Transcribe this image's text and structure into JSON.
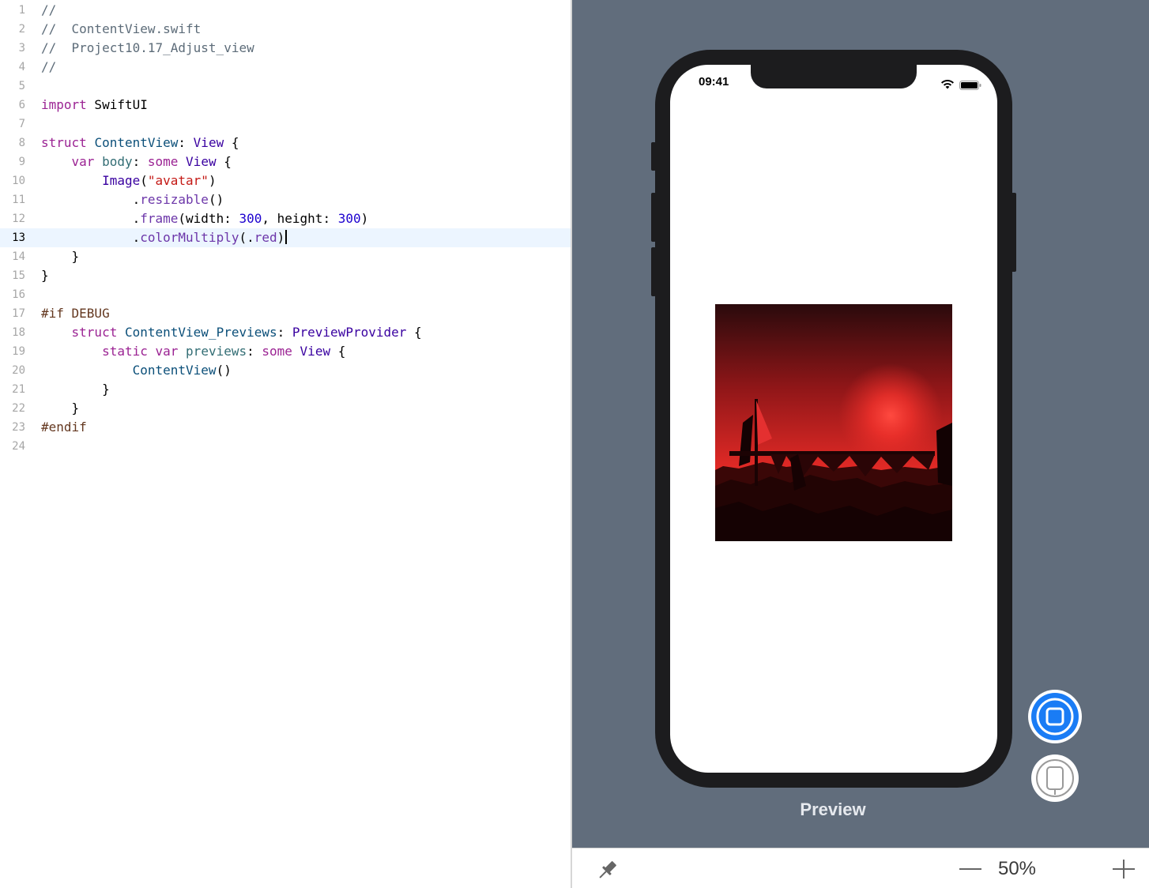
{
  "editor": {
    "current_line": 13,
    "lines": [
      {
        "n": "1",
        "tokens": [
          [
            "c",
            "//"
          ]
        ]
      },
      {
        "n": "2",
        "tokens": [
          [
            "c",
            "//  ContentView.swift"
          ]
        ]
      },
      {
        "n": "3",
        "tokens": [
          [
            "c",
            "//  Project10.17_Adjust_view"
          ]
        ]
      },
      {
        "n": "4",
        "tokens": [
          [
            "c",
            "//"
          ]
        ]
      },
      {
        "n": "5",
        "tokens": []
      },
      {
        "n": "6",
        "tokens": [
          [
            "k",
            "import"
          ],
          [
            "p",
            " SwiftUI"
          ]
        ]
      },
      {
        "n": "7",
        "tokens": []
      },
      {
        "n": "8",
        "tokens": [
          [
            "k",
            "struct"
          ],
          [
            "p",
            " "
          ],
          [
            "t",
            "ContentView"
          ],
          [
            "p",
            ": "
          ],
          [
            "s",
            "View"
          ],
          [
            "p",
            " {"
          ]
        ]
      },
      {
        "n": "9",
        "tokens": [
          [
            "p",
            "    "
          ],
          [
            "k",
            "var"
          ],
          [
            "p",
            " "
          ],
          [
            "r",
            "body"
          ],
          [
            "p",
            ": "
          ],
          [
            "k",
            "some"
          ],
          [
            "p",
            " "
          ],
          [
            "s",
            "View"
          ],
          [
            "p",
            " {"
          ]
        ]
      },
      {
        "n": "10",
        "tokens": [
          [
            "p",
            "        "
          ],
          [
            "s",
            "Image"
          ],
          [
            "p",
            "("
          ],
          [
            "q",
            "\"avatar\""
          ],
          [
            "p",
            ")"
          ]
        ]
      },
      {
        "n": "11",
        "tokens": [
          [
            "p",
            "            ."
          ],
          [
            "m",
            "resizable"
          ],
          [
            "p",
            "()"
          ]
        ]
      },
      {
        "n": "12",
        "tokens": [
          [
            "p",
            "            ."
          ],
          [
            "m",
            "frame"
          ],
          [
            "p",
            "(width: "
          ],
          [
            "d",
            "300"
          ],
          [
            "p",
            ", height: "
          ],
          [
            "d",
            "300"
          ],
          [
            "p",
            ")"
          ]
        ]
      },
      {
        "n": "13",
        "tokens": [
          [
            "p",
            "            ."
          ],
          [
            "m",
            "colorMultiply"
          ],
          [
            "p",
            "(."
          ],
          [
            "m",
            "red"
          ],
          [
            "p",
            ")"
          ]
        ]
      },
      {
        "n": "14",
        "tokens": [
          [
            "p",
            "    }"
          ]
        ]
      },
      {
        "n": "15",
        "tokens": [
          [
            "p",
            "}"
          ]
        ]
      },
      {
        "n": "16",
        "tokens": []
      },
      {
        "n": "17",
        "tokens": [
          [
            "x",
            "#if DEBUG"
          ]
        ]
      },
      {
        "n": "18",
        "tokens": [
          [
            "p",
            "    "
          ],
          [
            "k",
            "struct"
          ],
          [
            "p",
            " "
          ],
          [
            "t",
            "ContentView_Previews"
          ],
          [
            "p",
            ": "
          ],
          [
            "s",
            "PreviewProvider"
          ],
          [
            "p",
            " {"
          ]
        ]
      },
      {
        "n": "19",
        "tokens": [
          [
            "p",
            "        "
          ],
          [
            "k",
            "static"
          ],
          [
            "p",
            " "
          ],
          [
            "k",
            "var"
          ],
          [
            "p",
            " "
          ],
          [
            "r",
            "previews"
          ],
          [
            "p",
            ": "
          ],
          [
            "k",
            "some"
          ],
          [
            "p",
            " "
          ],
          [
            "s",
            "View"
          ],
          [
            "p",
            " {"
          ]
        ]
      },
      {
        "n": "20",
        "tokens": [
          [
            "p",
            "            "
          ],
          [
            "t",
            "ContentView"
          ],
          [
            "p",
            "()"
          ]
        ]
      },
      {
        "n": "21",
        "tokens": [
          [
            "p",
            "        }"
          ]
        ]
      },
      {
        "n": "22",
        "tokens": [
          [
            "p",
            "    }"
          ]
        ]
      },
      {
        "n": "23",
        "tokens": [
          [
            "x",
            "#endif"
          ]
        ]
      },
      {
        "n": "24",
        "tokens": []
      }
    ]
  },
  "preview": {
    "status_time": "09:41",
    "label": "Preview",
    "image_tint": "#ff2a1f"
  },
  "bottom_bar": {
    "zoom_level": "50%"
  },
  "colors": {
    "canvas": "#616d7c",
    "live_button": "#1a7cf5",
    "current_line_highlight": "#ecf5ff"
  },
  "icons": [
    "wifi-icon",
    "battery-icon",
    "live-preview-icon",
    "device-preview-icon",
    "pin-icon",
    "zoom-out-icon",
    "zoom-in-icon"
  ]
}
